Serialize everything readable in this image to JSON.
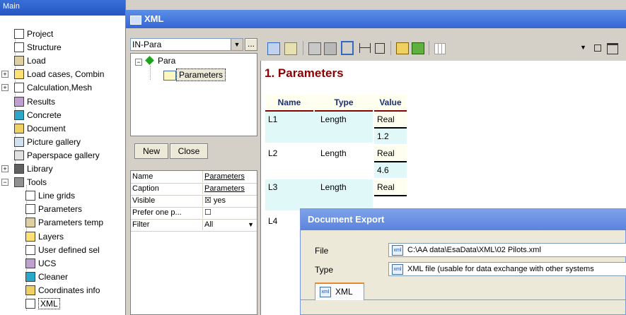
{
  "main": {
    "title": "Main",
    "tree": [
      {
        "label": "Project",
        "icon": "project-icon"
      },
      {
        "label": "Structure",
        "icon": "structure-icon"
      },
      {
        "label": "Load",
        "icon": "load-icon"
      },
      {
        "label": "Load cases, Combin",
        "icon": "load-cases-icon",
        "expander": "+"
      },
      {
        "label": "Calculation,Mesh",
        "icon": "calculation-icon",
        "expander": "+"
      },
      {
        "label": "Results",
        "icon": "results-icon"
      },
      {
        "label": "Concrete",
        "icon": "concrete-icon"
      },
      {
        "label": "Document",
        "icon": "document-icon"
      },
      {
        "label": "Picture gallery",
        "icon": "picture-gallery-icon"
      },
      {
        "label": "Paperspace gallery",
        "icon": "paperspace-gallery-icon"
      },
      {
        "label": "Library",
        "icon": "library-icon",
        "expander": "+"
      },
      {
        "label": "Tools",
        "icon": "tools-icon",
        "expander": "−"
      },
      {
        "label": "Line grids",
        "icon": "line-grids-icon",
        "child": true
      },
      {
        "label": "Parameters",
        "icon": "parameters-icon",
        "child": true
      },
      {
        "label": "Parameters temp",
        "icon": "parameters-template-icon",
        "child": true
      },
      {
        "label": "Layers",
        "icon": "layers-icon",
        "child": true
      },
      {
        "label": "User defined sel",
        "icon": "user-defined-icon",
        "child": true
      },
      {
        "label": "UCS",
        "icon": "ucs-icon",
        "child": true
      },
      {
        "label": "Cleaner",
        "icon": "cleaner-icon",
        "child": true
      },
      {
        "label": "Coordinates info",
        "icon": "coordinates-icon",
        "child": true
      },
      {
        "label": "XML",
        "icon": "xml-icon",
        "child": true,
        "selected": true
      }
    ]
  },
  "xml_window": {
    "title": "XML",
    "selector_value": "IN-Para",
    "selector_more": "...",
    "tree_root": "Para",
    "tree_child": "Parameters",
    "new_label": "New",
    "close_label": "Close",
    "properties": [
      {
        "name": "Name",
        "value": "Parameters"
      },
      {
        "name": "Caption",
        "value": "Parameters"
      },
      {
        "name": "Visible",
        "value": "☒ yes"
      },
      {
        "name": "Prefer one p...",
        "value": "☐"
      },
      {
        "name": "Filter",
        "value": "All"
      }
    ],
    "document": {
      "heading": "1. Parameters",
      "columns": [
        "Name",
        "Type",
        "Value"
      ],
      "rows": [
        {
          "name": "L1",
          "type": "Length",
          "value_type": "Real",
          "value": "1.2"
        },
        {
          "name": "L2",
          "type": "Length",
          "value_type": "Real",
          "value": "4.6"
        },
        {
          "name": "L3",
          "type": "Length",
          "value_type": "Real",
          "value": ""
        },
        {
          "name": "L4",
          "type": "",
          "value_type": "",
          "value": ""
        }
      ]
    }
  },
  "export_dialog": {
    "title": "Document Export",
    "file_label": "File",
    "file_value": "C:\\AA data\\EsaData\\XML\\02 Pilots.xml",
    "type_label": "Type",
    "type_value": "XML file (usable for data exchange with other systems",
    "tab_label": "XML"
  },
  "colors": {
    "title_bar": "#3566d4",
    "heading": "#8b0000",
    "header_row": "#fffff0",
    "row_band": "#e0f8f8",
    "value_cell": "#fffff0"
  }
}
